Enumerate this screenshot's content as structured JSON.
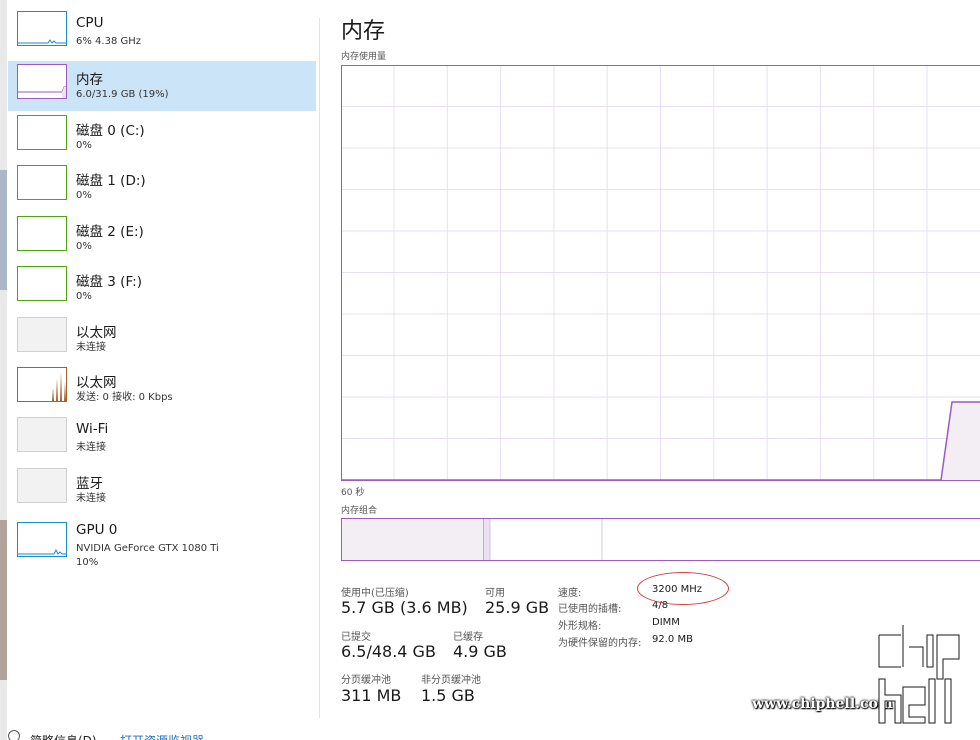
{
  "sidebar": {
    "items": [
      {
        "title": "CPU",
        "sub": "6% 4.38 GHz",
        "icon": "cpu-graph-icon"
      },
      {
        "title": "内存",
        "sub": "6.0/31.9 GB (19%)",
        "icon": "memory-graph-icon"
      },
      {
        "title": "磁盘 0 (C:)",
        "sub": "0%",
        "icon": "disk-graph-icon"
      },
      {
        "title": "磁盘 1 (D:)",
        "sub": "0%",
        "icon": "disk-graph-icon"
      },
      {
        "title": "磁盘 2 (E:)",
        "sub": "0%",
        "icon": "disk-graph-icon"
      },
      {
        "title": "磁盘 3 (F:)",
        "sub": "0%",
        "icon": "disk-graph-icon"
      },
      {
        "title": "以太网",
        "sub": "未连接",
        "icon": "ethernet-graph-icon"
      },
      {
        "title": "以太网",
        "sub": "发送: 0 接收: 0 Kbps",
        "icon": "ethernet-graph-icon"
      },
      {
        "title": "Wi-Fi",
        "sub": "未连接",
        "icon": "wifi-graph-icon"
      },
      {
        "title": "蓝牙",
        "sub": "未连接",
        "icon": "bluetooth-graph-icon"
      },
      {
        "title": "GPU 0",
        "sub": "NVIDIA GeForce GTX 1080 Ti",
        "sub2": "10%",
        "icon": "gpu-graph-icon"
      }
    ],
    "selected_index": 1
  },
  "main": {
    "title": "内存",
    "usage_label": "内存使用量",
    "time_label": "60 秒",
    "composition_label": "内存组合"
  },
  "stats": {
    "in_use_label": "使用中(已压缩)",
    "in_use_value": "5.7 GB (3.6 MB)",
    "available_label": "可用",
    "available_value": "25.9 GB",
    "committed_label": "已提交",
    "committed_value": "6.5/48.4 GB",
    "cached_label": "已缓存",
    "cached_value": "4.9 GB",
    "paged_label": "分页缓冲池",
    "paged_value": "311 MB",
    "nonpaged_label": "非分页缓冲池",
    "nonpaged_value": "1.5 GB"
  },
  "info": {
    "speed_label": "速度:",
    "speed_value": "3200 MHz",
    "slots_label": "已使用的插槽:",
    "slots_value": "4/8",
    "form_label": "外形规格:",
    "form_value": "DIMM",
    "reserved_label": "为硬件保留的内存:",
    "reserved_value": "92.0 MB"
  },
  "footer": {
    "less_details": "简略信息(D)",
    "open_monitor": "打开资源监视器"
  },
  "watermark": {
    "url": "www.chiphell.com",
    "logo_text": "chip hell"
  },
  "colors": {
    "memory": "#9d5ac1",
    "cpu": "#1a8cc8",
    "disk": "#4da60c",
    "ethernet": "#a7612f",
    "selected_bg": "#cce4f7",
    "highlight": "#d04040"
  }
}
